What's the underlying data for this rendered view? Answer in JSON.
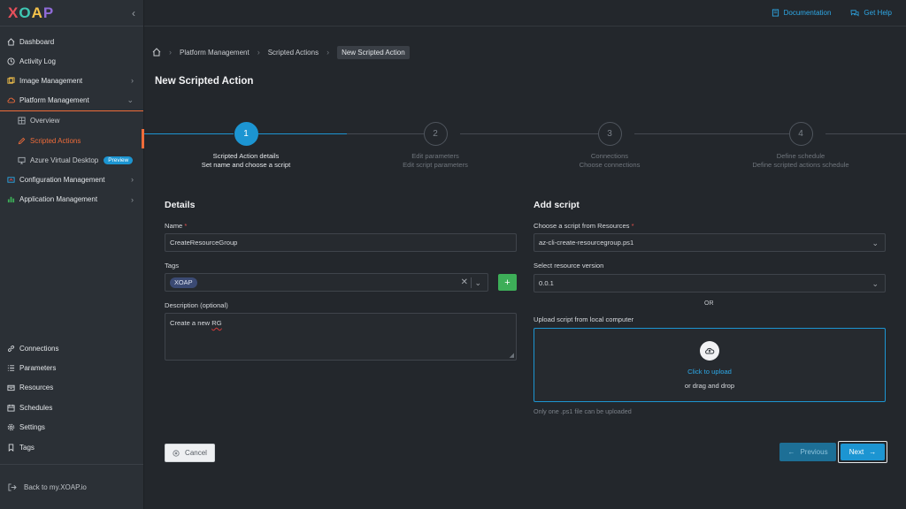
{
  "app": {
    "logo_letters": [
      "X",
      "O",
      "A",
      "P"
    ],
    "logo_colors": [
      "#e8505b",
      "#3ec7b3",
      "#f5c24a",
      "#8f6bd8"
    ]
  },
  "sidebar": {
    "collapse_icon": "chevron-left-icon",
    "items": [
      {
        "label": "Dashboard",
        "icon": "home-icon"
      },
      {
        "label": "Activity Log",
        "icon": "clock-icon"
      },
      {
        "label": "Image Management",
        "icon": "layers-icon"
      },
      {
        "label": "Platform Management",
        "icon": "cloud-icon"
      },
      {
        "label": "Overview",
        "icon": "grid-icon"
      },
      {
        "label": "Scripted Actions",
        "icon": "pen-icon"
      },
      {
        "label": "Azure Virtual Desktop",
        "icon": "monitor-icon",
        "badge": "Preview"
      },
      {
        "label": "Configuration Management",
        "icon": "gauge-icon"
      },
      {
        "label": "Application Management",
        "icon": "chart-icon"
      }
    ],
    "bottom_items": [
      {
        "label": "Connections",
        "icon": "link-icon"
      },
      {
        "label": "Parameters",
        "icon": "list-icon"
      },
      {
        "label": "Resources",
        "icon": "box-icon"
      },
      {
        "label": "Schedules",
        "icon": "calendar-icon"
      },
      {
        "label": "Settings",
        "icon": "gear-icon"
      },
      {
        "label": "Tags",
        "icon": "bookmark-icon"
      }
    ],
    "back_label": "Back to my.XOAP.io"
  },
  "topbar": {
    "documentation": "Documentation",
    "get_help": "Get Help"
  },
  "breadcrumb": {
    "items": [
      "Platform Management",
      "Scripted Actions",
      "New Scripted Action"
    ]
  },
  "page": {
    "title": "New Scripted Action"
  },
  "stepper": {
    "current_step": 1,
    "steps": [
      {
        "number": "1",
        "title": "Scripted Action details",
        "subtitle": "Set name and choose a script"
      },
      {
        "number": "2",
        "title": "Edit parameters",
        "subtitle": "Edit script parameters"
      },
      {
        "number": "3",
        "title": "Connections",
        "subtitle": "Choose connections"
      },
      {
        "number": "4",
        "title": "Define schedule",
        "subtitle": "Define scripted actions schedule"
      }
    ]
  },
  "details": {
    "section_title": "Details",
    "name_label": "Name",
    "name_value": "CreateResourceGroup",
    "tags_label": "Tags",
    "tag_value": "XOAP",
    "add_tag": "+",
    "description_label": "Description (optional)",
    "description_prefix": "Create a new ",
    "description_misspelled": "RG"
  },
  "script": {
    "section_title": "Add script",
    "choose_label": "Choose a script from Resources",
    "choose_value": "az-cli-create-resourcegroup.ps1",
    "version_label": "Select resource version",
    "version_value": "0.0.1",
    "or_text": "OR",
    "upload_label": "Upload script from local computer",
    "upload_link": "Click to upload",
    "upload_sub": "or drag and drop",
    "hint": "Only one .ps1 file can be uploaded"
  },
  "actions": {
    "cancel": "Cancel",
    "previous": "Previous",
    "next": "Next"
  },
  "colors": {
    "accent": "#1c95d2",
    "active_nav": "#ef6c3a",
    "add_button": "#3dae58",
    "required": "#e2504a"
  }
}
